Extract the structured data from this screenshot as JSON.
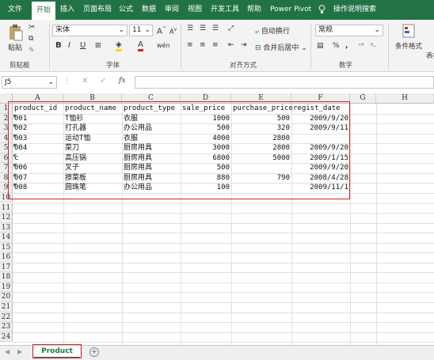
{
  "menu": {
    "tabs": [
      "文件",
      "开始",
      "插入",
      "页面布局",
      "公式",
      "数据",
      "审阅",
      "视图",
      "开发工具",
      "帮助",
      "Power Pivot"
    ],
    "active": "开始",
    "tell_me": "操作说明搜索"
  },
  "ribbon": {
    "clipboard": {
      "paste": "粘贴",
      "label": "剪贴板"
    },
    "font": {
      "name": "宋体",
      "size": "11",
      "grow": "A",
      "shrink": "A",
      "bold": "B",
      "italic": "I",
      "underline": "U",
      "wen": "wén",
      "label": "字体"
    },
    "alignment": {
      "wrap": "自动换行",
      "merge": "合并后居中",
      "label": "对齐方式"
    },
    "number": {
      "format": "常规",
      "label": "数字",
      "pct": "%",
      "comma": ","
    },
    "styles": {
      "cond": "条件格式",
      "table": "表格"
    }
  },
  "formula_bar": {
    "cell_ref": "J5",
    "fx": "fx",
    "value": ""
  },
  "columns": [
    "A",
    "B",
    "C",
    "D",
    "E",
    "F",
    "G",
    "H"
  ],
  "rows": [
    "1",
    "2",
    "3",
    "4",
    "5",
    "6",
    "7",
    "8",
    "9",
    "10",
    "11",
    "12",
    "13",
    "14",
    "15",
    "16",
    "17",
    "18",
    "19",
    "20",
    "21",
    "22",
    "23",
    "24"
  ],
  "table": {
    "headers": [
      "product_id",
      "product_name",
      "product_type",
      "sale_price",
      "purchase_price",
      "regist_date"
    ],
    "rows": [
      [
        "001",
        "T恤衫",
        "衣服",
        "1000",
        "500",
        "2009/9/20"
      ],
      [
        "002",
        "打孔器",
        "办公用品",
        "500",
        "320",
        "2009/9/11"
      ],
      [
        "003",
        "运动T恤",
        "衣服",
        "4000",
        "2800",
        ""
      ],
      [
        "004",
        "菜刀",
        "厨房用具",
        "3000",
        "2800",
        "2009/9/20"
      ],
      [
        "c",
        "高压锅",
        "厨房用具",
        "6800",
        "5000",
        "2009/1/15"
      ],
      [
        "006",
        "叉子",
        "厨房用具",
        "500",
        "",
        "2009/9/20"
      ],
      [
        "007",
        "擦菜板",
        "厨房用具",
        "880",
        "790",
        "2008/4/28"
      ],
      [
        "008",
        "圆珠笔",
        "办公用品",
        "100",
        "",
        "2009/11/1"
      ]
    ]
  },
  "sheet": {
    "tab": "Product",
    "add": "+"
  },
  "colors": {
    "brand": "#217346",
    "highlight": "#e02020"
  }
}
